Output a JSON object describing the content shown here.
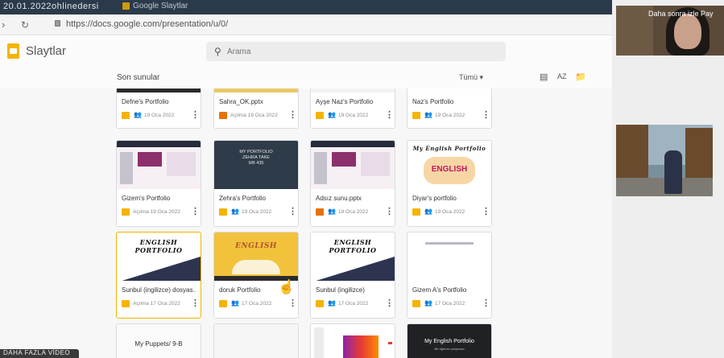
{
  "browser": {
    "tab_title": "20.01.2022ohlinedersi",
    "tab2_label": "Google Slaytlar",
    "url": "https://docs.google.com/presentation/u/0/"
  },
  "app": {
    "name": "Slaytlar",
    "search_placeholder": "Arama"
  },
  "filter": {
    "recent_label": "Son sunular",
    "owner_label": "Tümü ▾"
  },
  "files": [
    {
      "name": "Defne's Portfolio",
      "date": "19 Oca 2022",
      "type": "slides",
      "shared": true
    },
    {
      "name": "Sahra_OK.pptx",
      "date": "Açılma 19 Oca 2022",
      "type": "ppt",
      "shared": false
    },
    {
      "name": "Ayşe Naz's Portfolio",
      "date": "19 Oca 2022",
      "type": "slides",
      "shared": true
    },
    {
      "name": "Naz's Portfolio",
      "date": "19 Oca 2022",
      "type": "slides",
      "shared": true
    },
    {
      "name": "Gizem's Portfolio",
      "date": "Açılma 19 Oca 2022",
      "type": "slides",
      "shared": false
    },
    {
      "name": "Zehra's Portfolio",
      "date": "19 Oca 2022",
      "type": "slides",
      "shared": true
    },
    {
      "name": "Adsız sunu.pptx",
      "date": "19 Oca 2022",
      "type": "ppt",
      "shared": true
    },
    {
      "name": "Diyar's portfolio",
      "date": "19 Oca 2022",
      "type": "slides",
      "shared": true
    },
    {
      "name": "Sunbul (ingilizce) dosyas...",
      "date": "Açılma 17 Oca 2022",
      "type": "slides",
      "shared": false
    },
    {
      "name": "doruk Portfolio",
      "date": "17 Oca 2022",
      "type": "slides",
      "shared": true
    },
    {
      "name": "Sunbul (ingilizce)",
      "date": "17 Oca 2022",
      "type": "slides",
      "shared": true
    },
    {
      "name": "Gizem A's Portfolio",
      "date": "17 Oca 2022",
      "type": "slides",
      "shared": true
    },
    {
      "name": "My Puppets/ 9-B",
      "date": "",
      "type": "slides",
      "shared": false
    },
    {
      "name": "",
      "date": "",
      "type": "slides",
      "shared": false
    },
    {
      "name": "",
      "date": "",
      "type": "slides",
      "shared": false
    },
    {
      "name": "My English Portfolio",
      "date": "",
      "type": "slides",
      "shared": false
    }
  ],
  "thumbs": {
    "zehra_lines": [
      "MY PORTFOLIO",
      "ZEHRA TAKE",
      "9/B 435"
    ],
    "diyar_title": "My English Portfolio",
    "diyar_word": "ENGLISH",
    "english_portfolio": "ENGLISH PORTFOLIO",
    "english_book": "ENGLISH",
    "puppets_title": "My Puppets/ 9-B",
    "last_title": "My English Portfolio",
    "last_sub": "Bir öğrenci çalışması"
  },
  "video": {
    "caption": "Daha sonra izle   Pay",
    "badge": "DAHA FAZLA VİDEO"
  },
  "colors": {
    "slides": "#f4b400",
    "ppt": "#e8710a"
  }
}
